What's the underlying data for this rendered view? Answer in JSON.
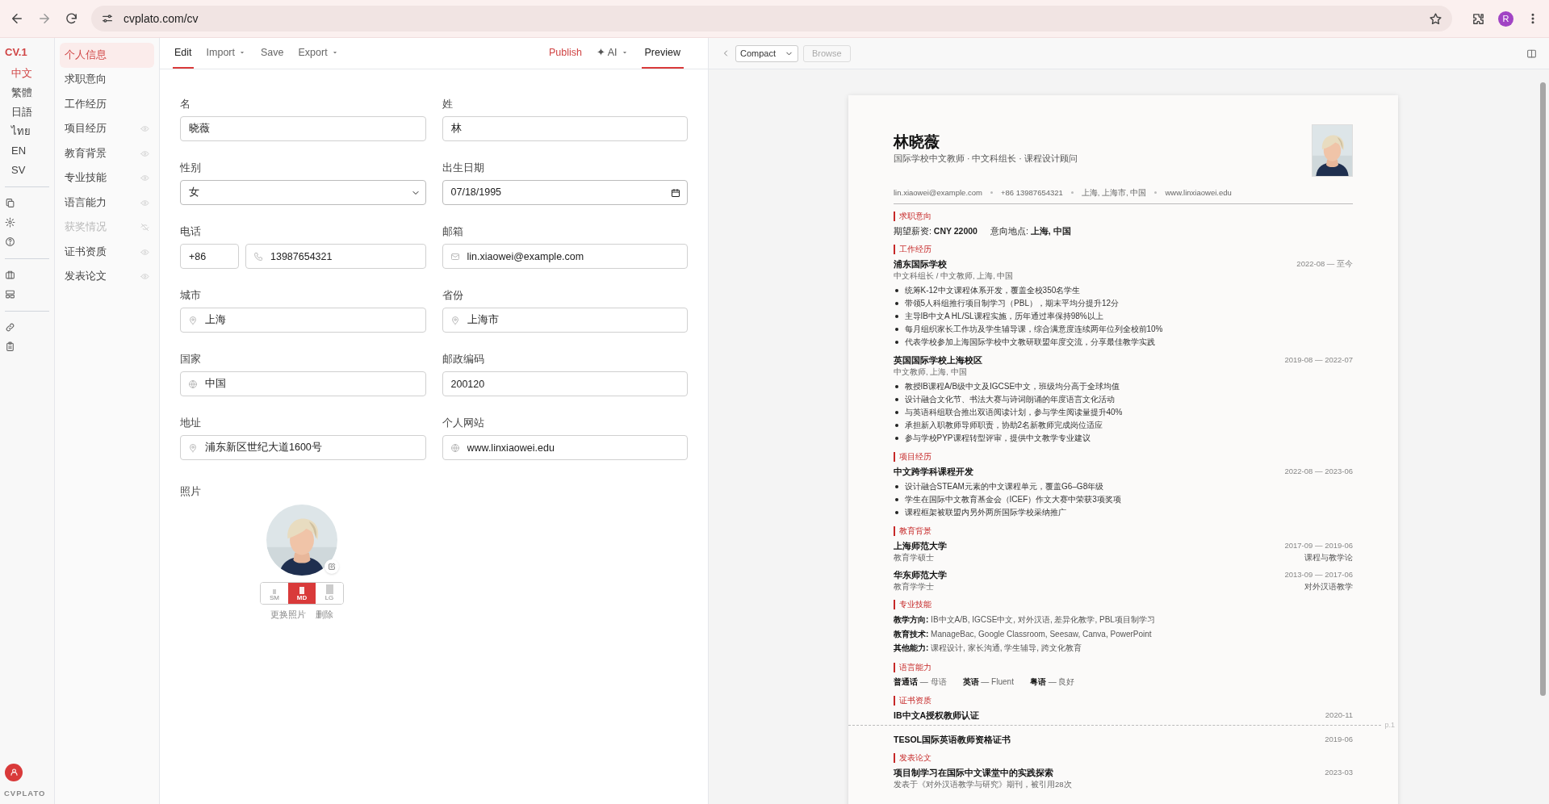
{
  "browser": {
    "url": "cvplato.com/cv",
    "profile": "R"
  },
  "rail": {
    "brand": "CV.1",
    "languages": [
      {
        "label": "中文",
        "selected": true
      },
      {
        "label": "繁體",
        "selected": false
      },
      {
        "label": "日語",
        "selected": false
      },
      {
        "label": "ไทย",
        "selected": false
      },
      {
        "label": "EN",
        "selected": false
      },
      {
        "label": "SV",
        "selected": false
      }
    ],
    "logo": "CVPLATO"
  },
  "sections": [
    {
      "label": "个人信息",
      "selected": true,
      "kind": "fixed",
      "hidden": false
    },
    {
      "label": "求职意向",
      "selected": false,
      "kind": "fixed",
      "hidden": false
    },
    {
      "label": "工作经历",
      "selected": false,
      "kind": "fixed",
      "hidden": false
    },
    {
      "label": "项目经历",
      "selected": false,
      "kind": "optional",
      "hidden": false
    },
    {
      "label": "教育背景",
      "selected": false,
      "kind": "optional",
      "hidden": false
    },
    {
      "label": "专业技能",
      "selected": false,
      "kind": "optional",
      "hidden": false
    },
    {
      "label": "语言能力",
      "selected": false,
      "kind": "optional",
      "hidden": false
    },
    {
      "label": "获奖情况",
      "selected": false,
      "kind": "optional",
      "hidden": true
    },
    {
      "label": "证书资质",
      "selected": false,
      "kind": "optional",
      "hidden": false
    },
    {
      "label": "发表论文",
      "selected": false,
      "kind": "optional",
      "hidden": false
    }
  ],
  "toolbar": {
    "items": [
      {
        "label": "Edit",
        "selected": true,
        "dropdown": false
      },
      {
        "label": "Import",
        "selected": false,
        "dropdown": true
      },
      {
        "label": "Save",
        "selected": false,
        "dropdown": false
      },
      {
        "label": "Export",
        "selected": false,
        "dropdown": true
      }
    ],
    "publish": "Publish",
    "ai": "✦ AI",
    "preview": {
      "label": "Preview",
      "selected": true
    }
  },
  "form": {
    "fields": [
      {
        "label": "名",
        "kind": "text",
        "value": "晓薇"
      },
      {
        "label": "姓",
        "kind": "text",
        "value": "林"
      },
      {
        "label": "性别",
        "kind": "select",
        "value": "女"
      },
      {
        "label": "出生日期",
        "kind": "date",
        "value": "07/18/1995"
      },
      {
        "label": "电话",
        "kind": "phone",
        "prefix": "+86",
        "value": "13987654321"
      },
      {
        "label": "邮箱",
        "kind": "email",
        "value": "lin.xiaowei@example.com"
      },
      {
        "label": "城市",
        "kind": "place",
        "value": "上海"
      },
      {
        "label": "省份",
        "kind": "place",
        "value": "上海市"
      },
      {
        "label": "国家",
        "kind": "country",
        "value": "中国"
      },
      {
        "label": "邮政编码",
        "kind": "text",
        "value": "200120"
      },
      {
        "label": "地址",
        "kind": "place",
        "value": "浦东新区世纪大道1600号"
      },
      {
        "label": "个人网站",
        "kind": "website",
        "value": "www.linxiaowei.edu"
      }
    ],
    "photo": {
      "label": "照片",
      "sizes": [
        {
          "label": "SM",
          "selected": false
        },
        {
          "label": "MD",
          "selected": true
        },
        {
          "label": "LG",
          "selected": false
        }
      ],
      "links": [
        "更换照片",
        "删除"
      ]
    }
  },
  "preview_toolbar": {
    "template": "Compact",
    "browse": "Browse"
  },
  "resume": {
    "name": "林晓薇",
    "subtitle": "国际学校中文教师 · 中文科组长 · 课程设计顾问",
    "contacts": [
      "lin.xiaowei@example.com",
      "+86 13987654321",
      "上海, 上海市, 中国",
      "www.linxiaowei.edu"
    ],
    "page_label": "p.1",
    "sections": [
      {
        "kind": "intent",
        "heading": "求职意向",
        "items": [
          "期望薪资: **CNY 22000**",
          "意向地点: **上海, 中国**"
        ]
      },
      {
        "kind": "entries",
        "heading": "工作经历",
        "entries": [
          {
            "title": "浦东国际学校",
            "date": "2022-08 — 至今",
            "subtitle": "中文科组长 / 中文教师, 上海, 中国",
            "bullets": [
              "统筹K-12中文课程体系开发，覆盖全校350名学生",
              "带领5人科组推行项目制学习（PBL），期末平均分提升12分",
              "主导IB中文A HL/SL课程实施，历年通过率保持98%以上",
              "每月组织家长工作坊及学生辅导课，综合满意度连续两年位列全校前10%",
              "代表学校参加上海国际学校中文教研联盟年度交流，分享最佳教学实践"
            ]
          },
          {
            "title": "英国国际学校上海校区",
            "date": "2019-08 — 2022-07",
            "subtitle": "中文教师, 上海, 中国",
            "bullets": [
              "教授IB课程A/B级中文及IGCSE中文，班级均分高于全球均值",
              "设计融合文化节、书法大赛与诗词朗诵的年度语言文化活动",
              "与英语科组联合推出双语阅读计划，参与学生阅读量提升40%",
              "承担新入职教师导师职责，协助2名新教师完成岗位适应",
              "参与学校PYP课程转型评审，提供中文教学专业建议"
            ]
          }
        ]
      },
      {
        "kind": "entries",
        "heading": "项目经历",
        "entries": [
          {
            "title": "中文跨学科课程开发",
            "date": "2022-08 — 2023-06",
            "bullets": [
              "设计融合STEAM元素的中文课程单元，覆盖G6–G8年级",
              "学生在国际中文教育基金会（ICEF）作文大赛中荣获3项奖项",
              "课程框架被联盟内另外两所国际学校采纳推广"
            ]
          }
        ]
      },
      {
        "kind": "entries",
        "heading": "教育背景",
        "entries": [
          {
            "title": "上海师范大学",
            "date": "2017-09 — 2019-06",
            "subtitle": "教育学硕士",
            "note": "课程与教学论"
          },
          {
            "title": "华东师范大学",
            "date": "2013-09 — 2017-06",
            "subtitle": "教育学学士",
            "note": "对外汉语教学"
          }
        ]
      },
      {
        "kind": "skills",
        "heading": "专业技能",
        "items": [
          "**教学方向:** IB中文A/B, IGCSE中文, 对外汉语, 差异化教学, PBL项目制学习",
          "**教育技术:** ManageBac, Google Classroom, Seesaw, Canva, PowerPoint",
          "**其他能力:** 课程设计, 家长沟通, 学生辅导, 跨文化教育"
        ]
      },
      {
        "kind": "languages",
        "heading": "语言能力",
        "items": [
          "**普通话** — 母语",
          "**英语** — Fluent",
          "**粤语** — 良好"
        ]
      },
      {
        "kind": "entries",
        "heading": "证书资质",
        "entries": [
          {
            "title": "IB中文A授权教师认证",
            "date": "2020-11",
            "page_break_after": true
          },
          {
            "title": "TESOL国际英语教师资格证书",
            "date": "2019-06",
            "page_break_after": false
          }
        ]
      },
      {
        "kind": "entries",
        "heading": "发表论文",
        "entries": [
          {
            "title": "项目制学习在国际中文课堂中的实践探索",
            "date": "2023-03",
            "subtitle": "发表于《对外汉语教学与研究》期刊，被引用28次"
          }
        ]
      }
    ]
  }
}
